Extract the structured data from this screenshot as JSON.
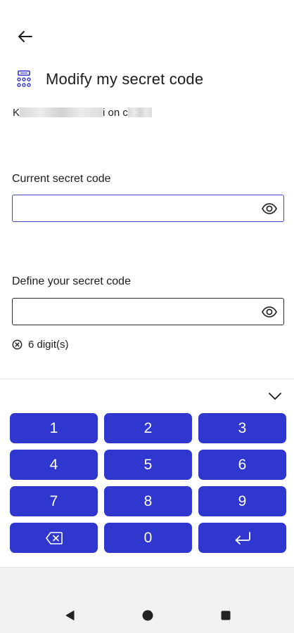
{
  "header": {
    "back_icon": "arrow-left-icon",
    "title_icon": "numeric-keypad-icon",
    "title": "Modify my secret code"
  },
  "account": {
    "prefix": "K",
    "middle": "i on c"
  },
  "current_code": {
    "label": "Current secret code",
    "value": "",
    "eye_icon": "eye-icon"
  },
  "new_code": {
    "label": "Define your secret code",
    "value": "",
    "eye_icon": "eye-icon"
  },
  "rules": [
    {
      "icon": "circle-x-icon",
      "text": "6 digit(s)"
    }
  ],
  "keyboard": {
    "collapse_icon": "chevron-down-icon",
    "keys": [
      "1",
      "2",
      "3",
      "4",
      "5",
      "6",
      "7",
      "8",
      "9",
      "backspace",
      "0",
      "enter"
    ]
  },
  "colors": {
    "accent": "#2f37cf",
    "focus_border": "#3f47c7",
    "nav_bar": "#f1f1f1"
  }
}
